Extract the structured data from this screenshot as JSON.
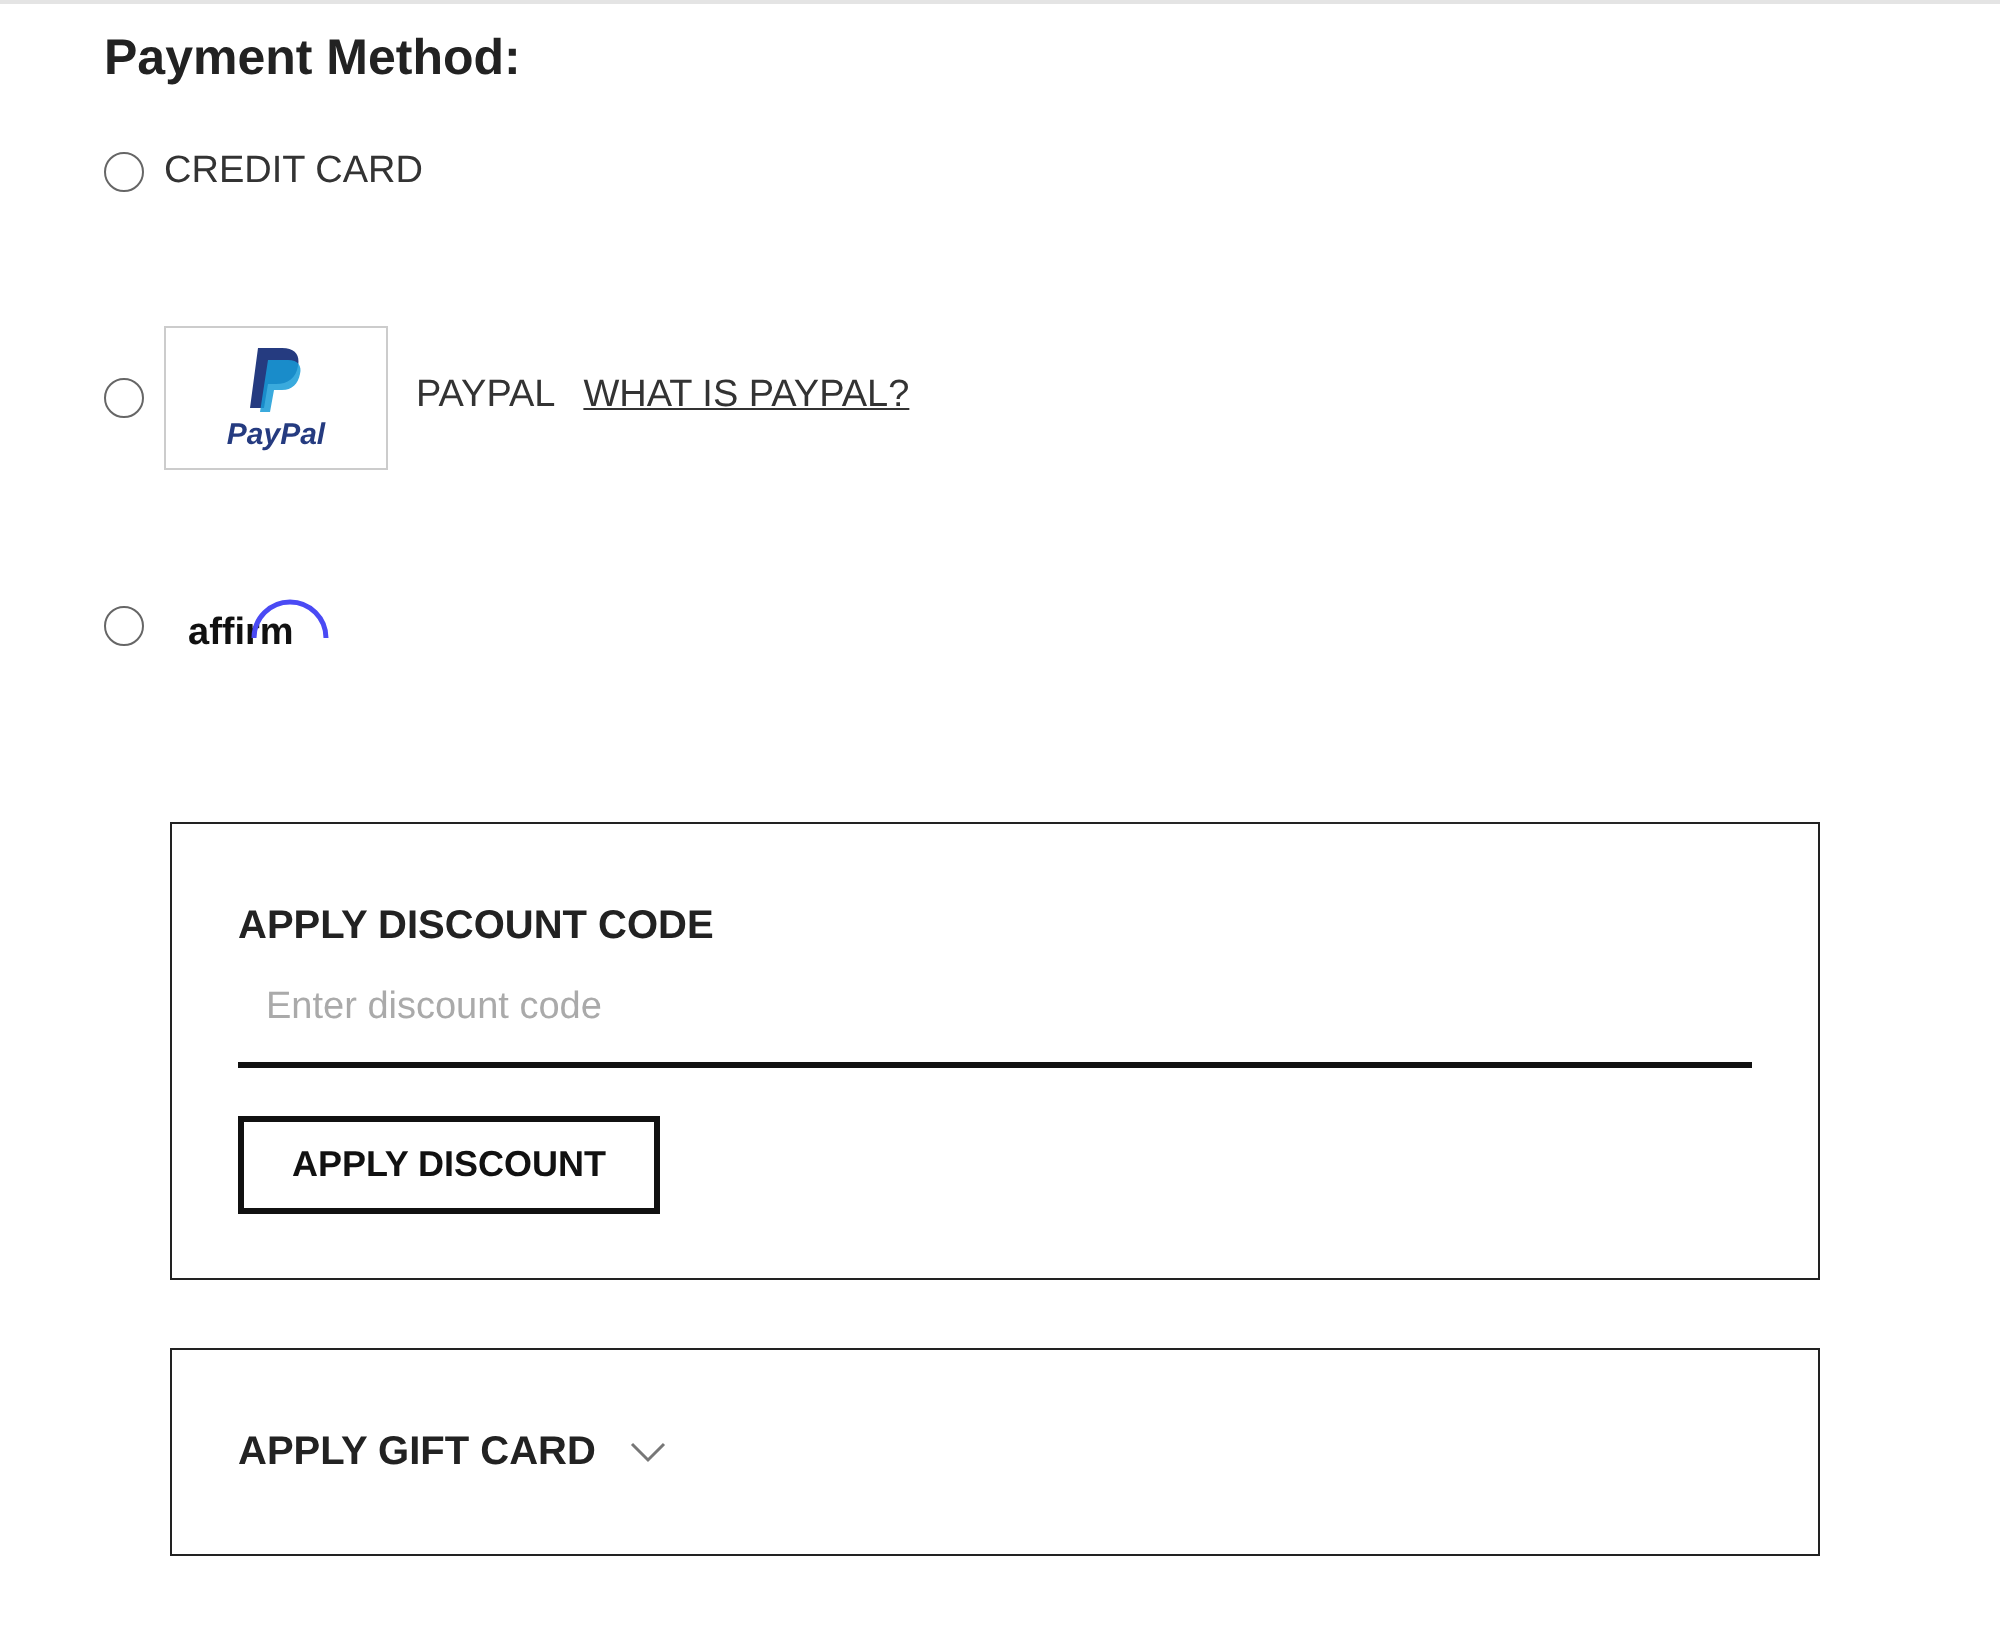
{
  "heading": "Payment Method:",
  "methods": [
    {
      "kind": "text",
      "label": "CREDIT CARD",
      "selected": false
    },
    {
      "kind": "paypal",
      "logo_text": "PayPal",
      "label": "PAYPAL",
      "link": "WHAT IS PAYPAL?",
      "selected": false
    },
    {
      "kind": "affirm",
      "logo_text": "affirm",
      "selected": false
    }
  ],
  "discount": {
    "title": "APPLY DISCOUNT CODE",
    "placeholder": "Enter discount code",
    "button": "APPLY DISCOUNT"
  },
  "gift_card": {
    "title": "APPLY GIFT CARD",
    "expanded": false
  }
}
